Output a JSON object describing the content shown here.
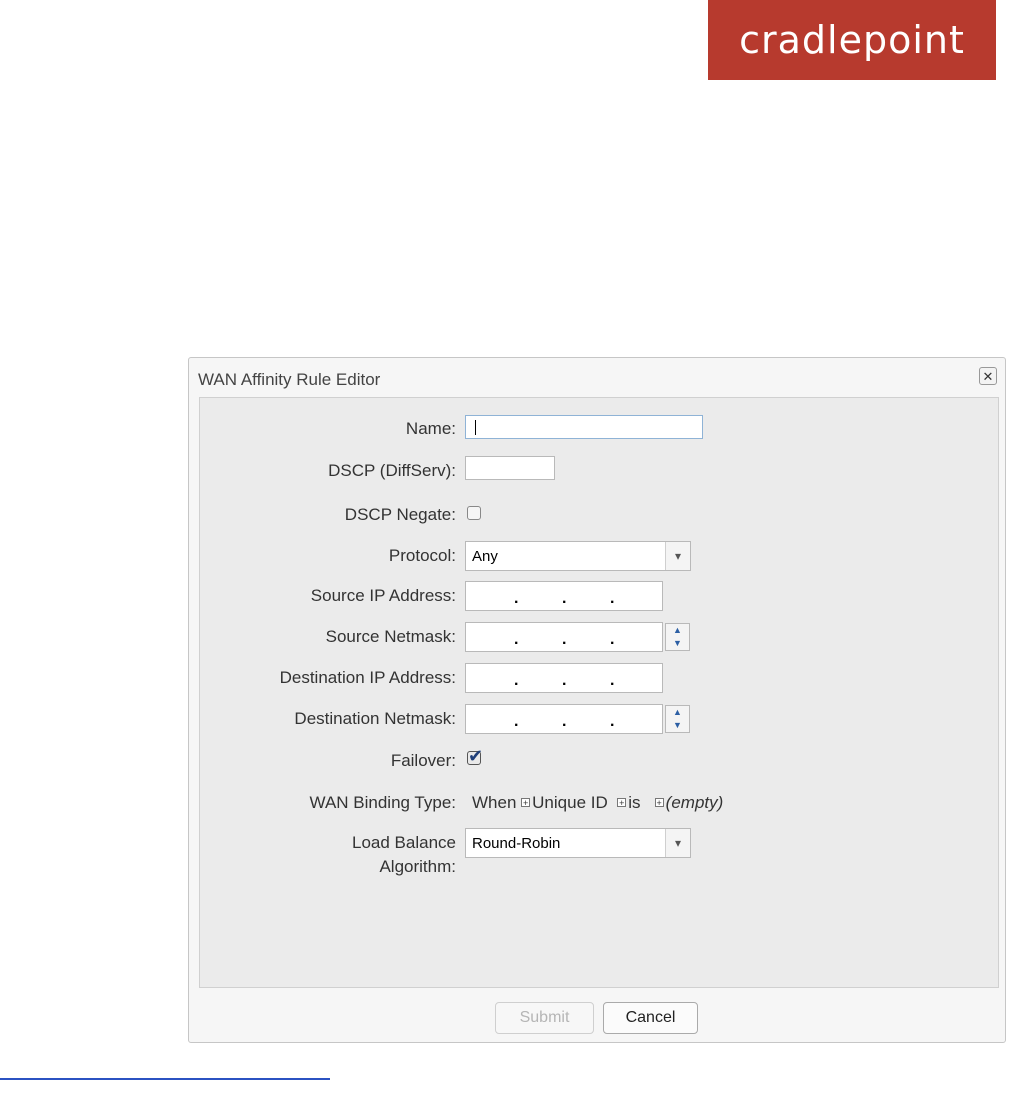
{
  "brand": {
    "logo_text": "cradlepoint",
    "color": "#b73a2e"
  },
  "dialog": {
    "title": "WAN Affinity Rule Editor",
    "close_glyph": "✕",
    "fields": {
      "name": {
        "label": "Name:",
        "value": ""
      },
      "dscp": {
        "label": "DSCP (DiffServ):",
        "value": ""
      },
      "dscp_negate": {
        "label": "DSCP Negate:",
        "checked": false
      },
      "protocol": {
        "label": "Protocol:",
        "value": "Any"
      },
      "source_ip": {
        "label": "Source IP Address:"
      },
      "source_netmask": {
        "label": "Source Netmask:"
      },
      "dest_ip": {
        "label": "Destination IP Address:"
      },
      "dest_netmask": {
        "label": "Destination Netmask:"
      },
      "failover": {
        "label": "Failover:",
        "checked": true
      },
      "wan_binding": {
        "label": "WAN Binding Type:",
        "when": "When",
        "unique_id": "Unique ID",
        "is": "is",
        "empty": "(empty)"
      },
      "load_balance": {
        "label_line1": "Load Balance",
        "label_line2": "Algorithm:",
        "value": "Round-Robin"
      }
    },
    "buttons": {
      "submit": "Submit",
      "cancel": "Cancel"
    }
  }
}
